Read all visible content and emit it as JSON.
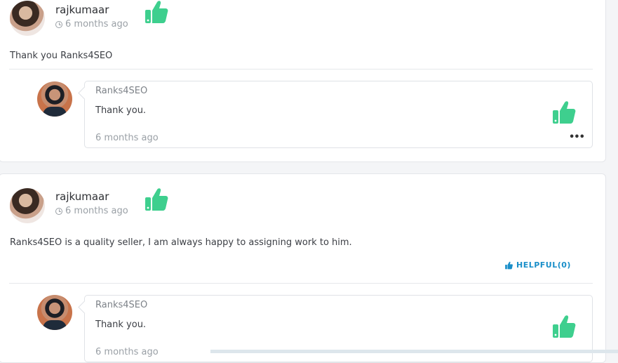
{
  "colors": {
    "accent_green": "#3ecf8e",
    "helpful_blue": "#1a8fc9",
    "muted_text": "#9aa0a6"
  },
  "reviews": [
    {
      "username": "rajkumaar",
      "time": "6 months ago",
      "text": "Thank you Ranks4SEO",
      "reply": {
        "name": "Ranks4SEO",
        "text": "Thank you.",
        "time": "6 months ago",
        "more_icon": "•••"
      }
    },
    {
      "username": "rajkumaar",
      "time": "6 months ago",
      "text": "Ranks4SEO is a quality seller, I am always happy to assigning work to him.",
      "helpful_label": "HELPFUL(0)",
      "reply": {
        "name": "Ranks4SEO",
        "text": "Thank you.",
        "time": "6 months ago"
      }
    }
  ],
  "icons": {
    "thumbs_up": "thumbs-up-icon",
    "clock": "clock-icon",
    "more": "more-options-icon"
  }
}
